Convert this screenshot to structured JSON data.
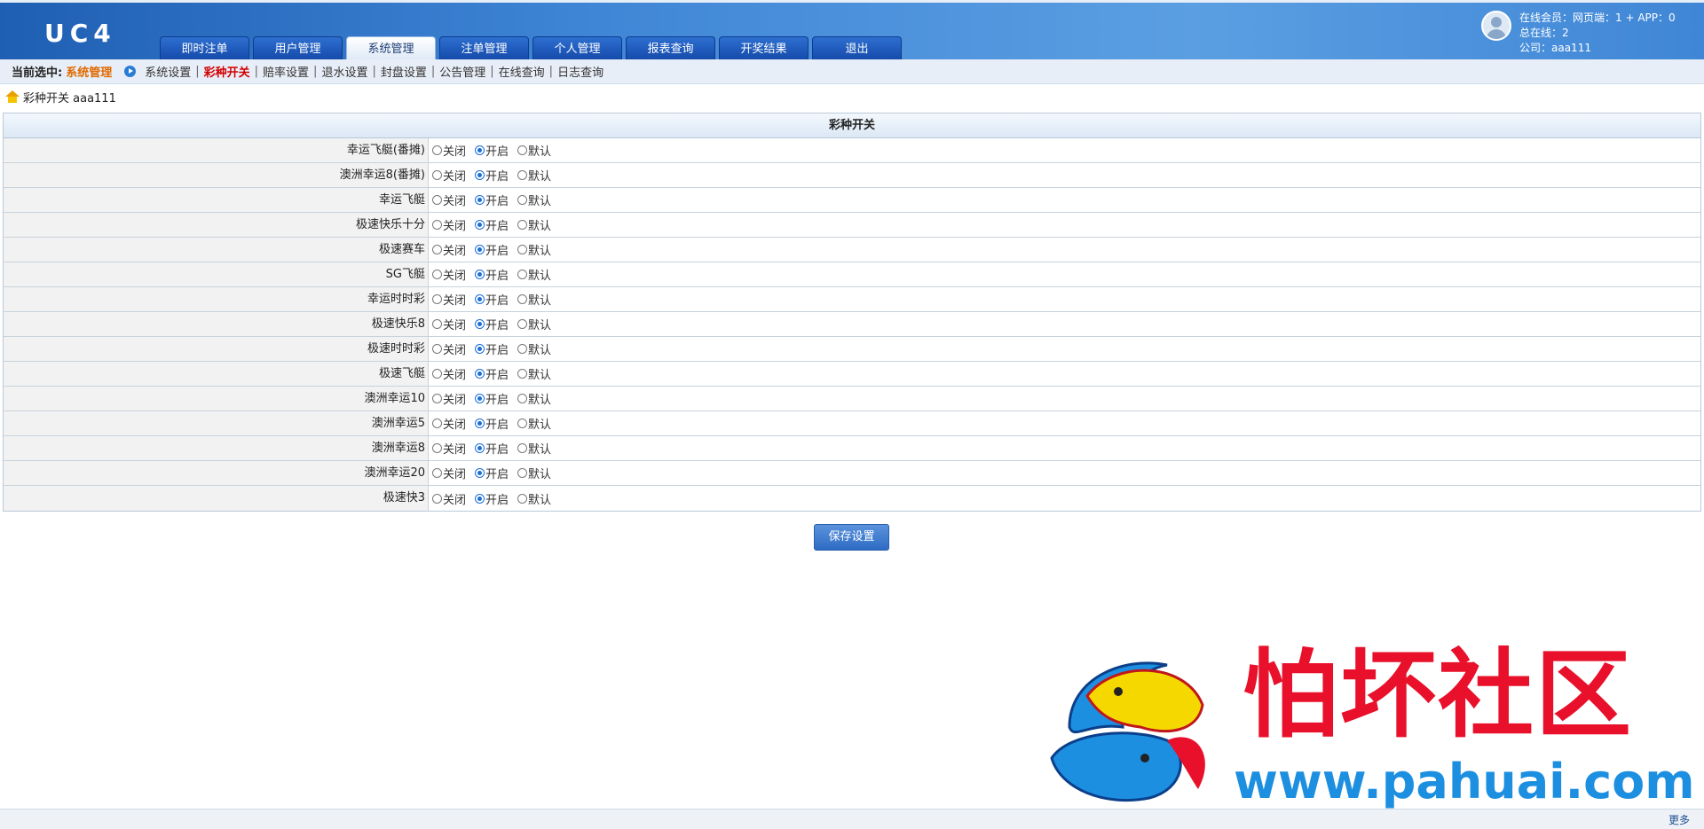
{
  "header": {
    "logo": "UC4",
    "nav_tabs": [
      {
        "label": "即时注单",
        "active": false
      },
      {
        "label": "用户管理",
        "active": false
      },
      {
        "label": "系统管理",
        "active": true
      },
      {
        "label": "注单管理",
        "active": false
      },
      {
        "label": "个人管理",
        "active": false
      },
      {
        "label": "报表查询",
        "active": false
      },
      {
        "label": "开奖结果",
        "active": false
      },
      {
        "label": "退出",
        "active": false
      }
    ],
    "online": {
      "line1": "在线会员：网页端：1 + APP：0",
      "line2": "总在线：2",
      "line3": "公司：aaa111"
    }
  },
  "subnav": {
    "current_label": "当前选中:",
    "current_value": "系统管理",
    "links": [
      {
        "label": "系统设置",
        "active": false
      },
      {
        "label": "彩种开关",
        "active": true
      },
      {
        "label": "赔率设置",
        "active": false
      },
      {
        "label": "退水设置",
        "active": false
      },
      {
        "label": "封盘设置",
        "active": false
      },
      {
        "label": "公告管理",
        "active": false
      },
      {
        "label": "在线查询",
        "active": false
      },
      {
        "label": "日志查询",
        "active": false
      }
    ]
  },
  "breadcrumb": "彩种开关 aaa111",
  "table": {
    "title": "彩种开关",
    "options": [
      "关闭",
      "开启",
      "默认"
    ],
    "rows": [
      {
        "label": "幸运飞艇(番摊)",
        "selected": "开启"
      },
      {
        "label": "澳洲幸运8(番摊)",
        "selected": "开启"
      },
      {
        "label": "幸运飞艇",
        "selected": "开启"
      },
      {
        "label": "极速快乐十分",
        "selected": "开启"
      },
      {
        "label": "极速赛车",
        "selected": "开启"
      },
      {
        "label": "SG飞艇",
        "selected": "开启"
      },
      {
        "label": "幸运时时彩",
        "selected": "开启"
      },
      {
        "label": "极速快乐8",
        "selected": "开启"
      },
      {
        "label": "极速时时彩",
        "selected": "开启"
      },
      {
        "label": "极速飞艇",
        "selected": "开启"
      },
      {
        "label": "澳洲幸运10",
        "selected": "开启"
      },
      {
        "label": "澳洲幸运5",
        "selected": "开启"
      },
      {
        "label": "澳洲幸运8",
        "selected": "开启"
      },
      {
        "label": "澳洲幸运20",
        "selected": "开启"
      },
      {
        "label": "极速快3",
        "selected": "开启"
      }
    ]
  },
  "save_label": "保存设置",
  "watermark": {
    "text": "怕坏社区",
    "url": "www.pahuai.com"
  },
  "footer": {
    "more_label": "更多"
  },
  "colors": {
    "header_blue": "#3f86d6",
    "tab_blue": "#1448a8",
    "active_red": "#d10000",
    "current_orange": "#e06a00",
    "watermark_red": "#e8102a",
    "watermark_blue": "#1d8fe0"
  }
}
